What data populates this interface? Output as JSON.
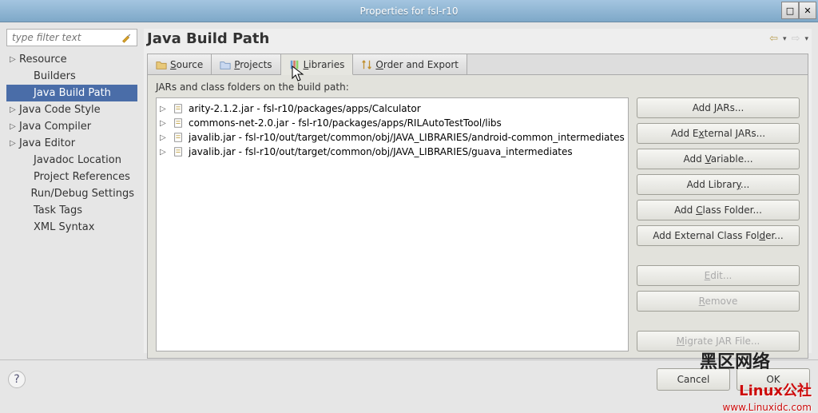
{
  "window": {
    "title": "Properties for fsl-r10"
  },
  "filter": {
    "placeholder": "type filter text"
  },
  "tree": {
    "items": [
      {
        "label": "Resource",
        "expandable": true,
        "indent": false
      },
      {
        "label": "Builders",
        "expandable": false,
        "indent": true
      },
      {
        "label": "Java Build Path",
        "expandable": false,
        "indent": true,
        "selected": true
      },
      {
        "label": "Java Code Style",
        "expandable": true,
        "indent": false
      },
      {
        "label": "Java Compiler",
        "expandable": true,
        "indent": false
      },
      {
        "label": "Java Editor",
        "expandable": true,
        "indent": false
      },
      {
        "label": "Javadoc Location",
        "expandable": false,
        "indent": true
      },
      {
        "label": "Project References",
        "expandable": false,
        "indent": true
      },
      {
        "label": "Run/Debug Settings",
        "expandable": false,
        "indent": true
      },
      {
        "label": "Task Tags",
        "expandable": false,
        "indent": true
      },
      {
        "label": "XML Syntax",
        "expandable": false,
        "indent": true
      }
    ]
  },
  "page": {
    "title": "Java Build Path"
  },
  "tabs": {
    "source": "Source",
    "projects": "Projects",
    "libraries": "Libraries",
    "order": "Order and Export"
  },
  "jars": {
    "header": "JARs and class folders on the build path:",
    "items": [
      "arity-2.1.2.jar - fsl-r10/packages/apps/Calculator",
      "commons-net-2.0.jar - fsl-r10/packages/apps/RILAutoTestTool/libs",
      "javalib.jar - fsl-r10/out/target/common/obj/JAVA_LIBRARIES/android-common_intermediates",
      "javalib.jar - fsl-r10/out/target/common/obj/JAVA_LIBRARIES/guava_intermediates"
    ]
  },
  "buttons": {
    "addJars": "Add JARs...",
    "addExternalJars": "Add External JARs...",
    "addVariable": "Add Variable...",
    "addLibrary": "Add Library...",
    "addClassFolder": "Add Class Folder...",
    "addExternalClassFolder": "Add External Class Folder...",
    "edit": "Edit...",
    "remove": "Remove",
    "migrate": "Migrate JAR File..."
  },
  "footer": {
    "cancel": "Cancel",
    "ok": "OK"
  },
  "watermark": {
    "cn": "黑区网络",
    "brand": "Linux公社",
    "url": "www.Linuxidc.com"
  }
}
